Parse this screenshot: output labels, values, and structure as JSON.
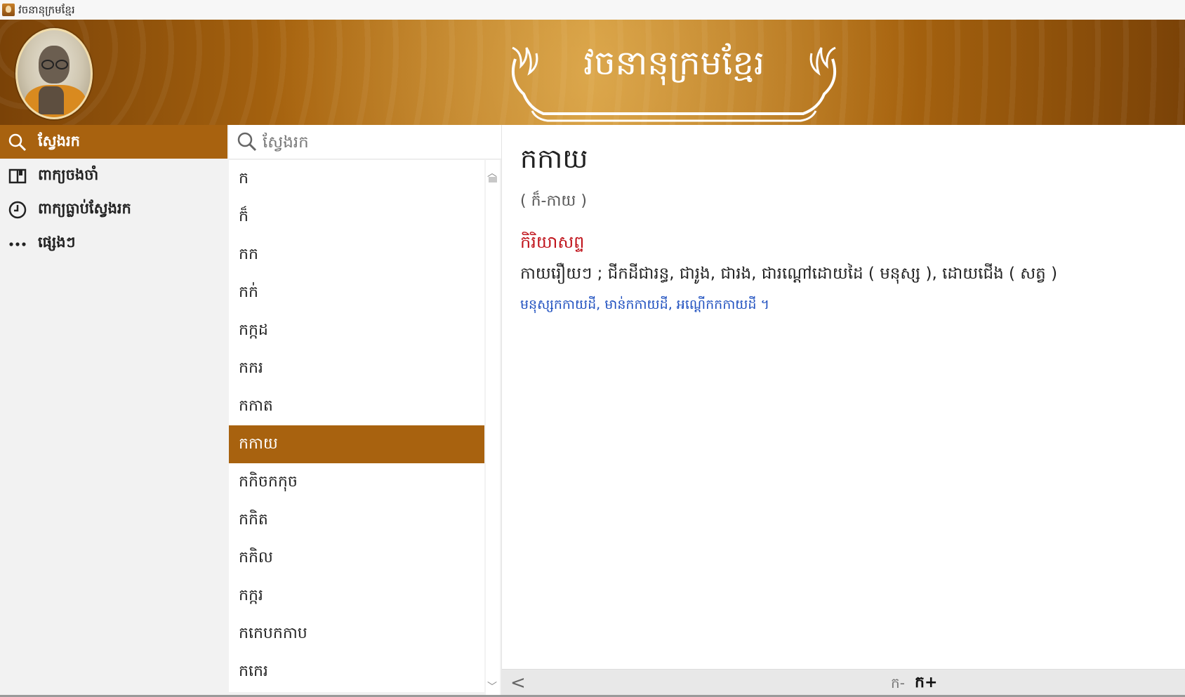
{
  "window": {
    "title": "វចនានុក្រមខ្មែរ"
  },
  "banner": {
    "title": "វចនានុក្រមខ្មែរ"
  },
  "sidebar": {
    "items": [
      {
        "label": "ស្វែងរក",
        "icon": "search-icon",
        "active": true
      },
      {
        "label": "ពាក្យចងចាំ",
        "icon": "book-icon",
        "active": false
      },
      {
        "label": "ពាក្យធ្លាប់ស្វែងរក",
        "icon": "clock-icon",
        "active": false
      },
      {
        "label": "ផ្សេងៗ",
        "icon": "more-icon",
        "active": false
      }
    ]
  },
  "search": {
    "placeholder": "ស្វែងរក",
    "value": ""
  },
  "wordlist": {
    "items": [
      "ក",
      "ក៏",
      "កក",
      "កក់",
      "កក្កដ",
      "កករ",
      "កកាត",
      "កកាយ",
      "កកិចកកុច",
      "កកិត",
      "កកិល",
      "កក្ករ",
      "កកេបកកាប",
      "កកេរ"
    ],
    "selected_index": 7
  },
  "entry": {
    "headword": "កកាយ",
    "pronunciation": "( ក៏-កាយ )",
    "part_of_speech": "កិរិយាសព្ទ",
    "definition": "កាយរឿយៗ ; ជីកដីជារន្ធ, ជារូង, ជារង, ជារណ្ដៅដោយដៃ ( មនុស្ស ), ដោយជើង ( សត្វ )",
    "example": "មនុស្សកកាយដី, មាន់កកាយដី, អណ្ដើកកកាយដី ។"
  },
  "footer": {
    "font_smaller": "ក-",
    "font_larger": "ក+"
  },
  "colors": {
    "accent": "#a8620f",
    "pos": "#c0141c",
    "example": "#1e4fbf"
  }
}
